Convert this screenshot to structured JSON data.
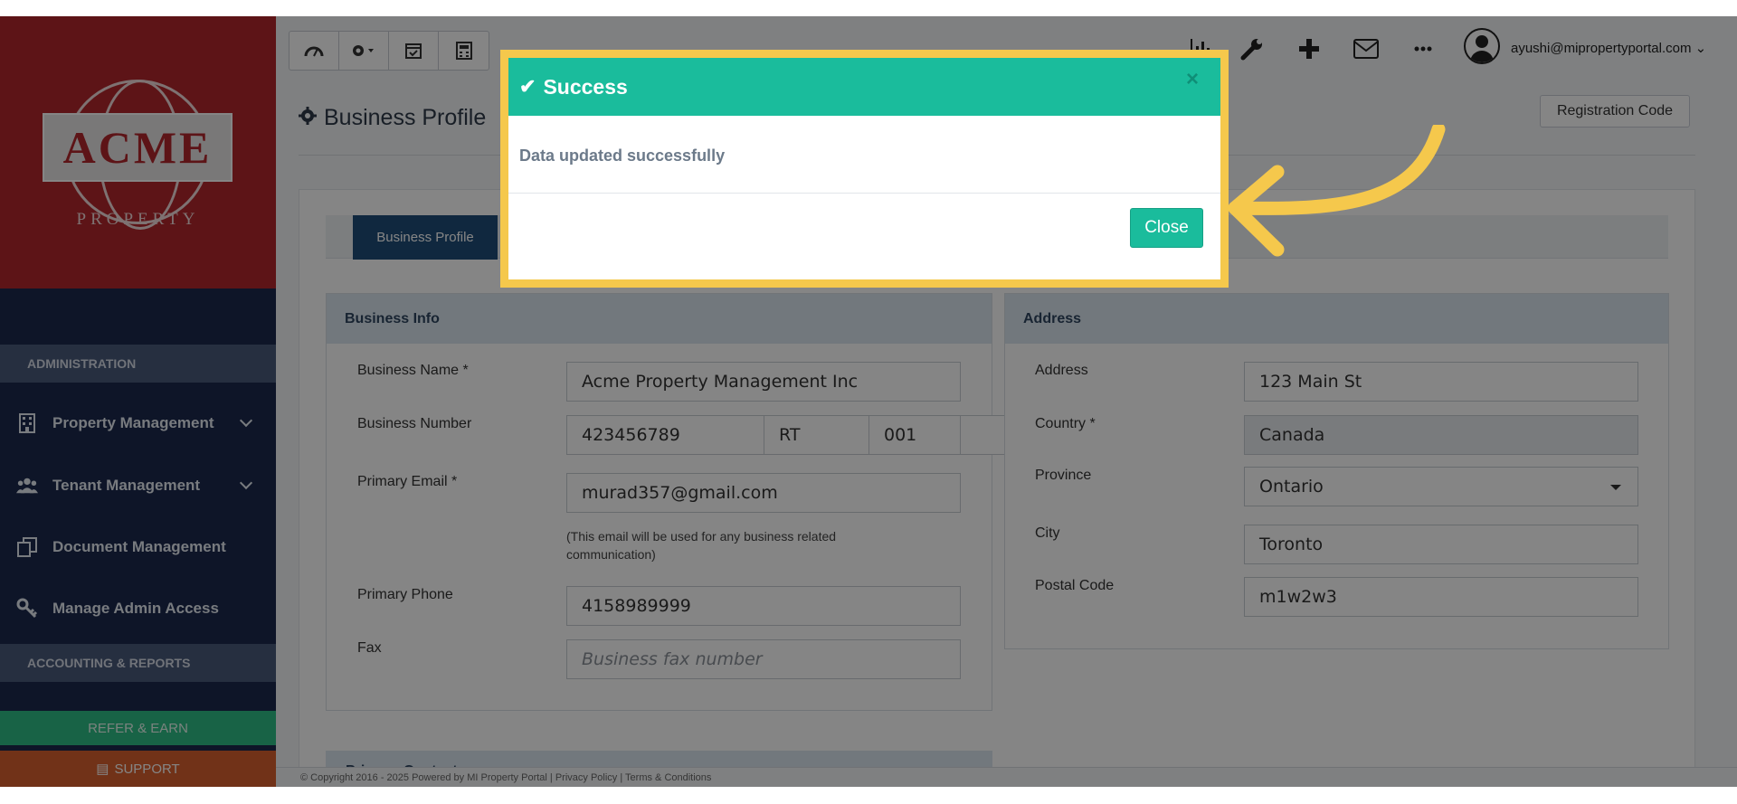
{
  "logo": {
    "brand": "ACME",
    "sub": "PROPERTY"
  },
  "sidebar": {
    "section_admin": "ADMINISTRATION",
    "items": [
      {
        "label": "Property Management",
        "icon": "building-icon",
        "has_chevron": true
      },
      {
        "label": "Tenant Management",
        "icon": "users-icon",
        "has_chevron": true
      },
      {
        "label": "Document Management",
        "icon": "copy-icon",
        "has_chevron": false
      },
      {
        "label": "Manage Admin Access",
        "icon": "key-icon",
        "has_chevron": false
      }
    ],
    "section_accounting": "ACCOUNTING & REPORTS",
    "refer": "REFER & EARN",
    "support": "SUPPORT"
  },
  "topbar": {
    "user": "ayushi@mipropertyportal.com"
  },
  "page": {
    "title": "Business Profile",
    "registration_button": "Registration Code",
    "tab_active": "Business Profile"
  },
  "business_info": {
    "header": "Business Info",
    "business_name_label": "Business Name *",
    "business_name": "Acme Property Management Inc",
    "business_number_label": "Business Number",
    "business_number": "423456789",
    "business_number_rt": "RT",
    "business_number_suffix": "001",
    "primary_email_label": "Primary Email *",
    "primary_email": "murad357@gmail.com",
    "primary_email_hint": "(This email will be used for any business related communication)",
    "primary_phone_label": "Primary Phone",
    "primary_phone": "4158989999",
    "fax_label": "Fax",
    "fax_placeholder": "Business fax number"
  },
  "address": {
    "header": "Address",
    "address_label": "Address",
    "address": "123 Main St",
    "country_label": "Country *",
    "country": "Canada",
    "province_label": "Province",
    "province": "Ontario",
    "city_label": "City",
    "city": "Toronto",
    "postal_label": "Postal Code",
    "postal": "m1w2w3"
  },
  "primary_contact": {
    "header": "Primary Contact"
  },
  "footer": {
    "text": "© Copyright 2016 - 2025 Powered by MI Property Portal | Privacy Policy | Terms & Conditions"
  },
  "modal": {
    "title": "Success",
    "message": "Data updated successfully",
    "close_label": "Close",
    "close_x": "×"
  },
  "colors": {
    "accent": "#1abc9c",
    "highlight_frame": "#f5c84c",
    "sidebar": "#1b2a4e",
    "logo_bg": "#b3272d"
  }
}
